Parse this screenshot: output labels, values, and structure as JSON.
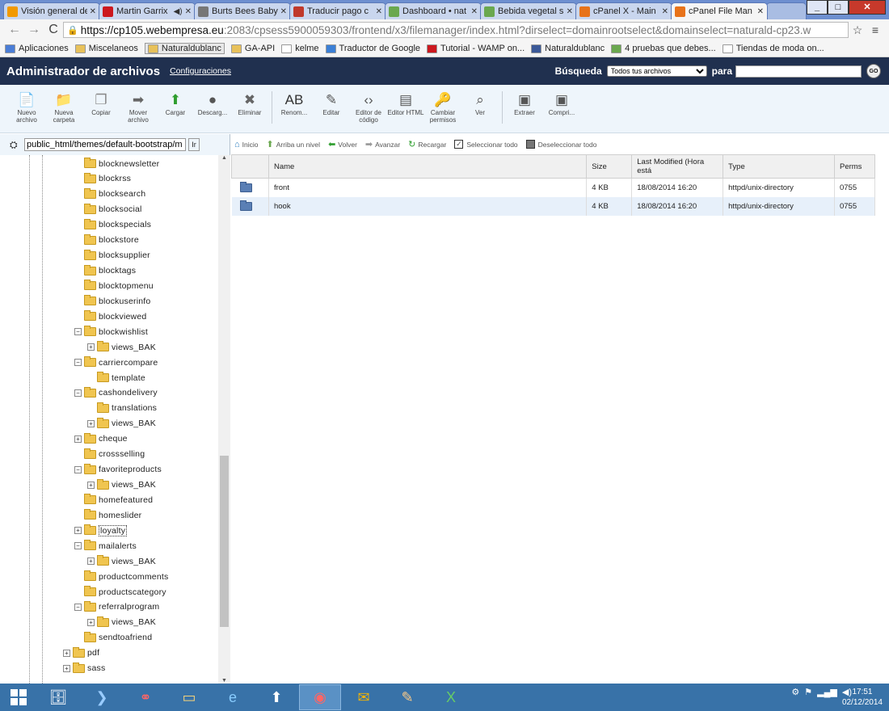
{
  "browser": {
    "tabs": [
      {
        "title": "Visión general de",
        "color": "#f29900",
        "active": false
      },
      {
        "title": "Martin Garrix",
        "color": "#cc181e",
        "active": false,
        "audio": true
      },
      {
        "title": "Burts Bees Baby",
        "color": "#777777",
        "active": false
      },
      {
        "title": "Traducir pago c",
        "color": "#c0392b",
        "active": false
      },
      {
        "title": "Dashboard • nat",
        "color": "#6aa84f",
        "active": false
      },
      {
        "title": "Bebida vegetal s",
        "color": "#6aa84f",
        "active": false
      },
      {
        "title": "cPanel X - Main",
        "color": "#e8731a",
        "active": false
      },
      {
        "title": "cPanel File Man",
        "color": "#e8731a",
        "active": true
      }
    ],
    "url_host": "https://cp105.webempresa.eu",
    "url_rest": ":2083/cpsess5900059303/frontend/x3/filemanager/index.html?dirselect=domainrootselect&domainselect=naturald-cp23.w",
    "bookmarks": [
      {
        "label": "Aplicaciones",
        "color": "#4a7dd6",
        "selected": false
      },
      {
        "label": "Miscelaneos",
        "color": "#e8c15a",
        "selected": false
      },
      {
        "label": "Naturaldublanc",
        "color": "#e8c15a",
        "selected": true
      },
      {
        "label": "GA-API",
        "color": "#e8c15a",
        "selected": false
      },
      {
        "label": "kelme",
        "color": "#ffffff",
        "selected": false
      },
      {
        "label": "Traductor de Google",
        "color": "#3b7fd6",
        "selected": false
      },
      {
        "label": "Tutorial - WAMP on...",
        "color": "#cc181e",
        "selected": false
      },
      {
        "label": "Naturaldublanc",
        "color": "#3b5998",
        "selected": false
      },
      {
        "label": "4 pruebas que debes...",
        "color": "#6aa84f",
        "selected": false
      },
      {
        "label": "Tiendas de moda on...",
        "color": "#ffffff",
        "selected": false
      }
    ]
  },
  "header": {
    "title": "Administrador de archivos",
    "config_link": "Configuraciones",
    "search_label": "Búsqueda",
    "search_option": "Todos tus archivos",
    "for_label": "para",
    "go_label": "GO"
  },
  "toolbar": [
    {
      "label": "Nuevo archivo",
      "icon": "new-file-icon",
      "glyph": "📄",
      "color": "#2f9e2f"
    },
    {
      "label": "Nueva carpeta",
      "icon": "new-folder-icon",
      "glyph": "📁",
      "color": "#d9a11e"
    },
    {
      "label": "Copiar",
      "icon": "copy-icon",
      "glyph": "❐",
      "color": "#888"
    },
    {
      "label": "Mover archivo",
      "icon": "move-file-icon",
      "glyph": "➡",
      "color": "#666"
    },
    {
      "label": "Cargar",
      "icon": "upload-icon",
      "glyph": "⬆",
      "color": "#2f9e2f"
    },
    {
      "label": "Descarg...",
      "icon": "download-icon",
      "glyph": "●",
      "color": "#555"
    },
    {
      "label": "Eliminar",
      "icon": "delete-icon",
      "glyph": "✖",
      "color": "#666"
    },
    {
      "label": "Renom...",
      "icon": "rename-icon",
      "glyph": "AB",
      "color": "#333"
    },
    {
      "label": "Editar",
      "icon": "edit-icon",
      "glyph": "✎",
      "color": "#555"
    },
    {
      "label": "Editor de código",
      "icon": "code-editor-icon",
      "glyph": "‹›",
      "color": "#555"
    },
    {
      "label": "Editor HTML",
      "icon": "html-editor-icon",
      "glyph": "▤",
      "color": "#555"
    },
    {
      "label": "Cambiar permisos",
      "icon": "permissions-icon",
      "glyph": "🔑",
      "color": "#888"
    },
    {
      "label": "Ver",
      "icon": "view-icon",
      "glyph": "⌕",
      "color": "#555"
    },
    {
      "label": "Extraer",
      "icon": "extract-icon",
      "glyph": "▣",
      "color": "#555"
    },
    {
      "label": "Compri...",
      "icon": "compress-icon",
      "glyph": "▣",
      "color": "#555"
    }
  ],
  "path": {
    "value": "public_html/themes/default-bootstrap/m",
    "go_label": "Ir"
  },
  "tree": [
    {
      "name": "blocknewsletter",
      "level": 0,
      "exp": ""
    },
    {
      "name": "blockrss",
      "level": 0,
      "exp": ""
    },
    {
      "name": "blocksearch",
      "level": 0,
      "exp": ""
    },
    {
      "name": "blocksocial",
      "level": 0,
      "exp": ""
    },
    {
      "name": "blockspecials",
      "level": 0,
      "exp": ""
    },
    {
      "name": "blockstore",
      "level": 0,
      "exp": ""
    },
    {
      "name": "blocksupplier",
      "level": 0,
      "exp": ""
    },
    {
      "name": "blocktags",
      "level": 0,
      "exp": ""
    },
    {
      "name": "blocktopmenu",
      "level": 0,
      "exp": ""
    },
    {
      "name": "blockuserinfo",
      "level": 0,
      "exp": ""
    },
    {
      "name": "blockviewed",
      "level": 0,
      "exp": ""
    },
    {
      "name": "blockwishlist",
      "level": 0,
      "exp": "-"
    },
    {
      "name": "views_BAK",
      "level": 1,
      "exp": "+"
    },
    {
      "name": "carriercompare",
      "level": 0,
      "exp": "-"
    },
    {
      "name": "template",
      "level": 1,
      "exp": ""
    },
    {
      "name": "cashondelivery",
      "level": 0,
      "exp": "-"
    },
    {
      "name": "translations",
      "level": 1,
      "exp": ""
    },
    {
      "name": "views_BAK",
      "level": 1,
      "exp": "+"
    },
    {
      "name": "cheque",
      "level": 0,
      "exp": "+"
    },
    {
      "name": "crossselling",
      "level": 0,
      "exp": ""
    },
    {
      "name": "favoriteproducts",
      "level": 0,
      "exp": "-"
    },
    {
      "name": "views_BAK",
      "level": 1,
      "exp": "+"
    },
    {
      "name": "homefeatured",
      "level": 0,
      "exp": ""
    },
    {
      "name": "homeslider",
      "level": 0,
      "exp": ""
    },
    {
      "name": "loyalty",
      "level": 0,
      "exp": "+",
      "selected": true
    },
    {
      "name": "mailalerts",
      "level": 0,
      "exp": "-"
    },
    {
      "name": "views_BAK",
      "level": 1,
      "exp": "+"
    },
    {
      "name": "productcomments",
      "level": 0,
      "exp": ""
    },
    {
      "name": "productscategory",
      "level": 0,
      "exp": ""
    },
    {
      "name": "referralprogram",
      "level": 0,
      "exp": "-"
    },
    {
      "name": "views_BAK",
      "level": 1,
      "exp": "+"
    },
    {
      "name": "sendtoafriend",
      "level": 0,
      "exp": ""
    },
    {
      "name": "pdf",
      "level": -1,
      "exp": "+"
    },
    {
      "name": "sass",
      "level": -1,
      "exp": "+"
    }
  ],
  "actions": [
    {
      "label": "Inicio",
      "glyph": "⌂",
      "color": "#2f7fbf"
    },
    {
      "label": "Arriba un nivel",
      "glyph": "⬆",
      "color": "#6aa84f"
    },
    {
      "label": "Volver",
      "glyph": "⬅",
      "color": "#2f9e2f"
    },
    {
      "label": "Avanzar",
      "glyph": "➡",
      "color": "#999"
    },
    {
      "label": "Recargar",
      "glyph": "↻",
      "color": "#2f9e2f"
    }
  ],
  "select_all": "Seleccionar todo",
  "deselect_all": "Deseleccionar todo",
  "table": {
    "headers": [
      "",
      "Name",
      "Size",
      "Last Modified (Hora está",
      "Type",
      "Perms"
    ],
    "rows": [
      {
        "name": "front",
        "size": "4 KB",
        "modified": "18/08/2014 16:20",
        "type": "httpd/unix-directory",
        "perms": "0755"
      },
      {
        "name": "hook",
        "size": "4 KB",
        "modified": "18/08/2014 16:20",
        "type": "httpd/unix-directory",
        "perms": "0755"
      }
    ]
  },
  "taskbar": {
    "time": "17:51",
    "date": "02/12/2014"
  }
}
